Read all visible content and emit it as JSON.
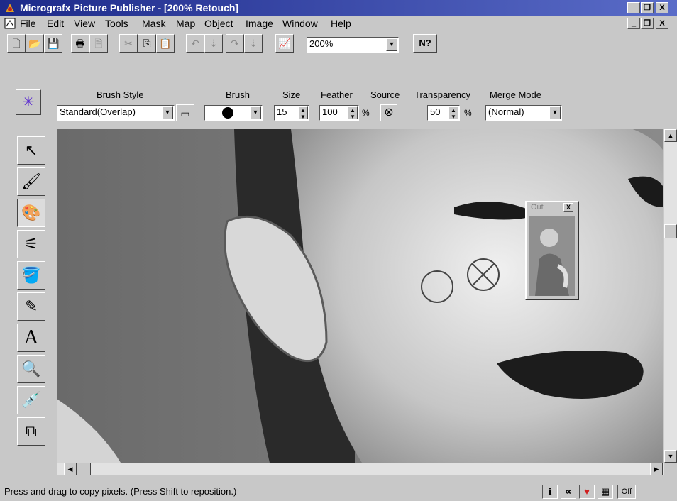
{
  "window": {
    "title": "Micrografx Picture Publisher - [200% Retouch]",
    "min": "_",
    "restore": "❐",
    "close": "X"
  },
  "menu": {
    "items": [
      "File",
      "Edit",
      "View",
      "Tools",
      "Mask",
      "Map",
      "Object",
      "Image",
      "Window",
      "Help"
    ]
  },
  "toolbar": {
    "zoom_value": "200%",
    "help_icon": "N?"
  },
  "options": {
    "brush_style_label": "Brush Style",
    "brush_style_value": "Standard(Overlap)",
    "brush_label": "Brush",
    "size_label": "Size",
    "size_value": "15",
    "feather_label": "Feather",
    "feather_value": "100",
    "feather_unit": "%",
    "source_label": "Source",
    "transparency_label": "Transparency",
    "transparency_value": "50",
    "transparency_unit": "%",
    "merge_mode_label": "Merge Mode",
    "merge_mode_value": "(Normal)"
  },
  "floating_window": {
    "title": "Out",
    "close": "X"
  },
  "status": {
    "message": "Press and drag to copy pixels. (Press Shift to reposition.)",
    "right_text": "Off"
  },
  "colors": {
    "titlebar_start": "#1d2a8a",
    "titlebar_end": "#5a6cc8",
    "face": "#c8c8c8"
  }
}
